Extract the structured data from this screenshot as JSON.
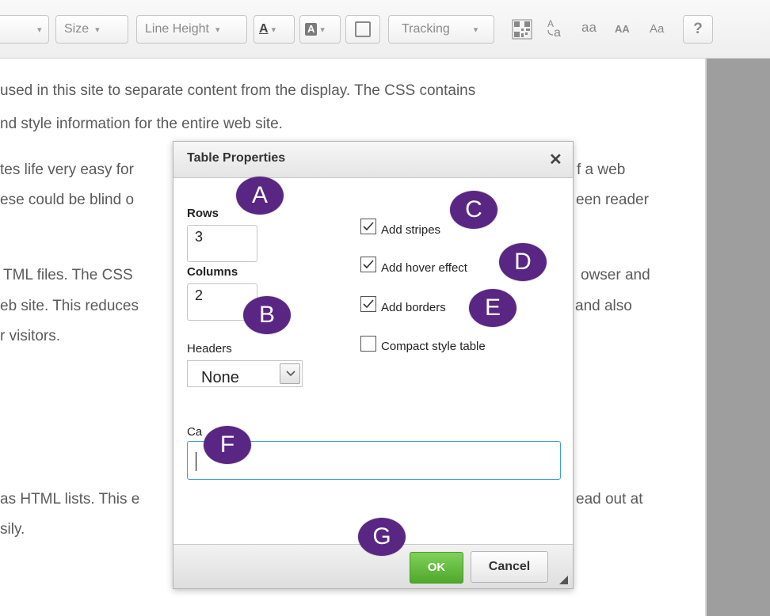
{
  "toolbar": {
    "font_caret": "▾",
    "size_label": "Size",
    "line_height_label": "Line Height",
    "font_color_glyph": "A",
    "bg_color_glyph": "A",
    "tracking_label": "Tracking",
    "case_lower": "aa",
    "case_upper": "AA",
    "case_title": "Aa",
    "help_label": "?"
  },
  "document": {
    "lines": [
      "used in this site to separate content from the display. The CSS contains",
      "nd style information for the entire web site.",
      "tes life very easy for",
      "f a web",
      "ese could be blind o",
      "een reader",
      "TML files. The CSS",
      "owser and",
      "eb site. This reduces",
      "and also",
      "r visitors.",
      "as HTML lists. This e",
      "ead out at",
      "sily."
    ]
  },
  "dialog": {
    "title": "Table Properties",
    "close_glyph": "✕",
    "rows_label": "Rows",
    "rows_value": "3",
    "columns_label": "Columns",
    "columns_value": "2",
    "headers_label": "Headers",
    "headers_selected": "None",
    "caption_label": "Ca",
    "caption_value": "",
    "checkboxes": [
      {
        "label": "Add stripes",
        "checked": true
      },
      {
        "label": "Add hover effect",
        "checked": true
      },
      {
        "label": "Add borders",
        "checked": true
      },
      {
        "label": "Compact style table",
        "checked": false
      }
    ],
    "ok_label": "OK",
    "cancel_label": "Cancel"
  },
  "annotations": [
    "A",
    "B",
    "C",
    "D",
    "E",
    "F",
    "G"
  ],
  "colors": {
    "badge": "#5a2683",
    "ok_button": "#5cb636",
    "caption_focus": "#3f9fd6"
  }
}
